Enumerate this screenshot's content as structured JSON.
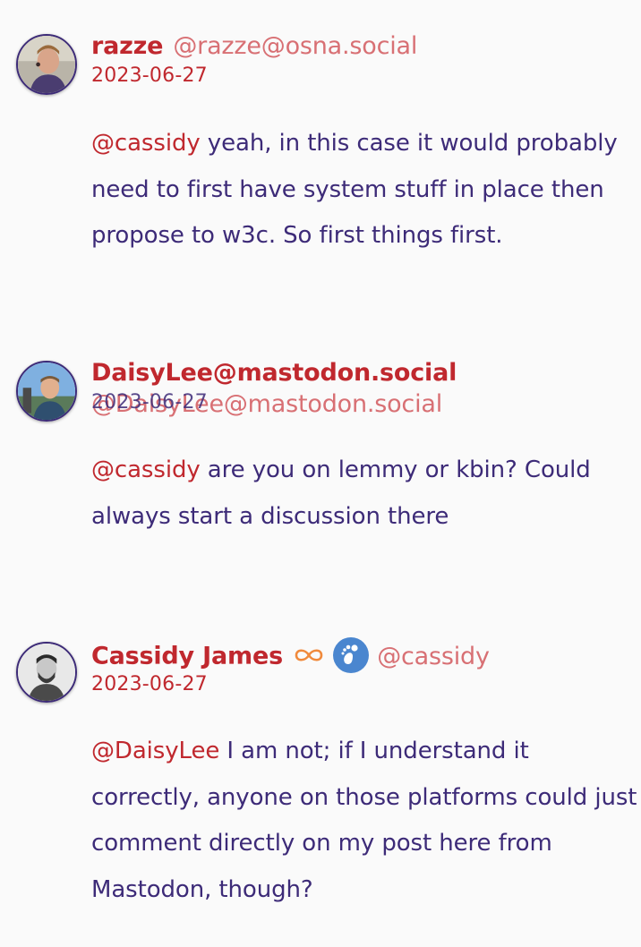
{
  "comments": [
    {
      "name": "razze",
      "handle": "@razze@osna.social",
      "date": "2023-06-27",
      "mention": "@cassidy",
      "text": " yeah, in this case it would probably need to first have system stuff in place then propose to w3c. So first things first.",
      "avatar_icon": "avatar-razze"
    },
    {
      "name": "DaisyLee@mastodon.social",
      "handle": "@DaisyLee@mastodon.social",
      "date": "2023-06-27",
      "mention": "@cassidy",
      "text": " are you on lemmy or kbin? Could always start a discussion there",
      "avatar_icon": "avatar-daisylee"
    },
    {
      "name": "Cassidy James",
      "handle": "@cassidy",
      "date": "2023-06-27",
      "mention": "@DaisyLee",
      "text": " I am not; if I understand it correctly, anyone on those platforms could just comment directly on my post here from Mastodon, though?",
      "avatar_icon": "avatar-cassidy",
      "badges": [
        "infinity-icon",
        "gnome-foot-icon"
      ]
    }
  ],
  "colors": {
    "name": "#c0282e",
    "handle": "#d87074",
    "body": "#3d2b78",
    "background": "#fafafa",
    "infinity": "#f08a3c",
    "gnome": "#4a86cf"
  }
}
